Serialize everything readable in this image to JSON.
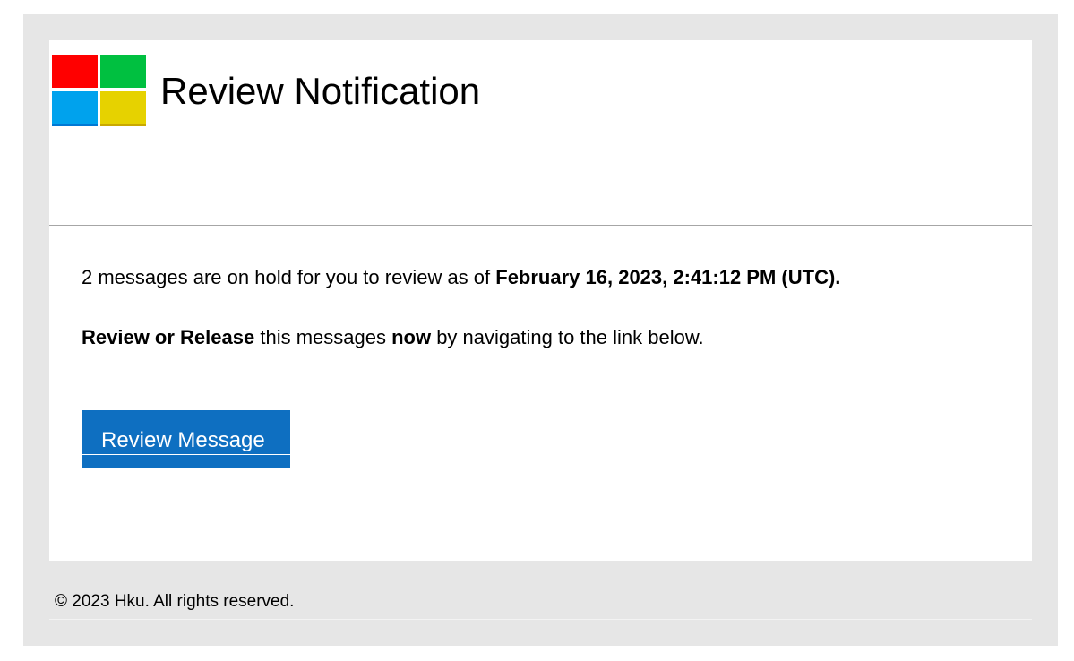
{
  "header": {
    "title": "Review Notification",
    "logo": {
      "icon": "windows-logo-icon",
      "colors": [
        "#ff0000",
        "#00c040",
        "#00a2ed",
        "#e6d200"
      ]
    }
  },
  "body": {
    "line1_prefix": "2 messages are on hold for you to review as of ",
    "line1_date": "February 16, 2023, 2:41:12 PM (UTC).",
    "line2_bold_1": "Review or Release",
    "line2_mid": " this messages ",
    "line2_bold_2": "now",
    "line2_suffix": " by navigating to the link below."
  },
  "cta": {
    "label": "Review Message",
    "color": "#0e6fc1"
  },
  "footer": {
    "copyright": "© 2023 Hku. All rights reserved."
  }
}
